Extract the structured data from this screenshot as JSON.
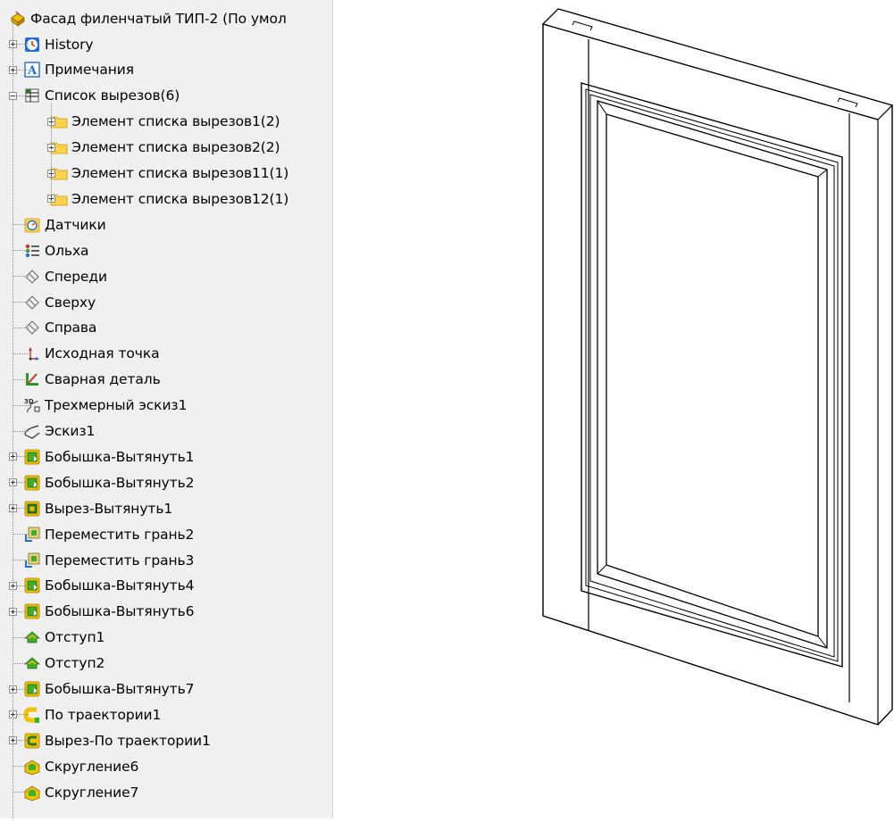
{
  "tree": {
    "root_label": "Фасад филенчатый ТИП-2  (По умол",
    "items": [
      {
        "label": "History",
        "icon": "history-icon",
        "expander": "plus",
        "level": 1
      },
      {
        "label": "Примечания",
        "icon": "annotations-icon",
        "expander": "plus",
        "level": 1
      },
      {
        "label": "Список вырезов(6)",
        "icon": "cut-list-icon",
        "expander": "minus",
        "level": 1
      },
      {
        "label": "Элемент списка вырезов1(2)",
        "icon": "folder-icon",
        "expander": "plus",
        "level": 2
      },
      {
        "label": "Элемент списка вырезов2(2)",
        "icon": "folder-icon",
        "expander": "plus",
        "level": 2
      },
      {
        "label": "Элемент списка вырезов11(1)",
        "icon": "folder-icon",
        "expander": "plus",
        "level": 2
      },
      {
        "label": "Элемент списка вырезов12(1)",
        "icon": "folder-icon",
        "expander": "plus",
        "level": 2
      },
      {
        "label": "Датчики",
        "icon": "sensors-icon",
        "expander": "none",
        "level": 1
      },
      {
        "label": "Ольха",
        "icon": "material-icon",
        "expander": "none",
        "level": 1
      },
      {
        "label": "Спереди",
        "icon": "plane-icon",
        "expander": "none",
        "level": 1
      },
      {
        "label": "Сверху",
        "icon": "plane-icon",
        "expander": "none",
        "level": 1
      },
      {
        "label": "Справа",
        "icon": "plane-icon",
        "expander": "none",
        "level": 1
      },
      {
        "label": "Исходная точка",
        "icon": "origin-icon",
        "expander": "none",
        "level": 1
      },
      {
        "label": "Сварная деталь",
        "icon": "weldment-icon",
        "expander": "none",
        "level": 1
      },
      {
        "label": "Трехмерный эскиз1",
        "icon": "3d-sketch-icon",
        "expander": "none",
        "level": 1
      },
      {
        "label": "Эскиз1",
        "icon": "sketch-icon",
        "expander": "none",
        "level": 1
      },
      {
        "label": "Бобышка-Вытянуть1",
        "icon": "extrude-boss-icon",
        "expander": "plus",
        "level": 1
      },
      {
        "label": "Бобышка-Вытянуть2",
        "icon": "extrude-boss-icon",
        "expander": "plus",
        "level": 1
      },
      {
        "label": "Вырез-Вытянуть1",
        "icon": "extrude-cut-icon",
        "expander": "plus",
        "level": 1
      },
      {
        "label": "Переместить грань2",
        "icon": "move-face-icon",
        "expander": "none",
        "level": 1
      },
      {
        "label": "Переместить грань3",
        "icon": "move-face-icon",
        "expander": "none",
        "level": 1
      },
      {
        "label": "Бобышка-Вытянуть4",
        "icon": "extrude-boss-icon",
        "expander": "plus",
        "level": 1
      },
      {
        "label": "Бобышка-Вытянуть6",
        "icon": "extrude-boss-icon",
        "expander": "plus",
        "level": 1
      },
      {
        "label": "Отступ1",
        "icon": "offset-icon",
        "expander": "none",
        "level": 1
      },
      {
        "label": "Отступ2",
        "icon": "offset-icon",
        "expander": "none",
        "level": 1
      },
      {
        "label": "Бобышка-Вытянуть7",
        "icon": "extrude-boss-icon",
        "expander": "plus",
        "level": 1
      },
      {
        "label": "По траектории1",
        "icon": "sweep-icon",
        "expander": "plus",
        "level": 1
      },
      {
        "label": "Вырез-По траектории1",
        "icon": "sweep-cut-icon",
        "expander": "plus",
        "level": 1
      },
      {
        "label": "Скругление6",
        "icon": "fillet-icon",
        "expander": "none",
        "level": 1
      },
      {
        "label": "Скругление7",
        "icon": "fillet-icon",
        "expander": "none",
        "level": 1
      }
    ]
  },
  "colors": {
    "panel_bg": "#f0f0f0",
    "folder": "#ffd24d",
    "feature_green": "#3fae2a",
    "feature_yellow": "#f2c200",
    "history_blue": "#1f6fd6"
  }
}
